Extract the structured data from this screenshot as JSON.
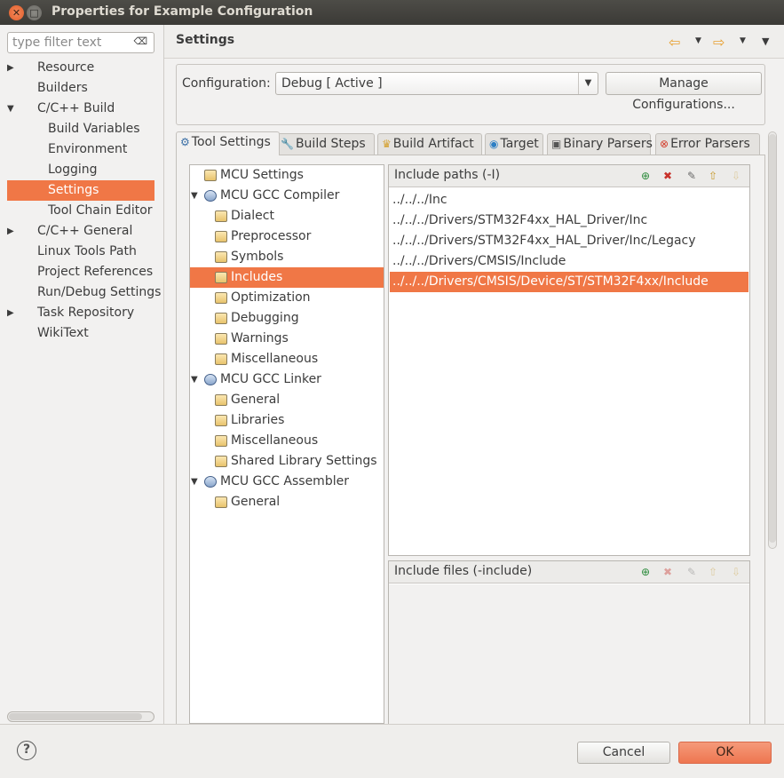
{
  "window": {
    "title": "Properties for Example Configuration"
  },
  "filter": {
    "placeholder": "type filter text"
  },
  "nav": {
    "items": [
      {
        "label": "Resource",
        "level": 0,
        "arrow": "▶"
      },
      {
        "label": "Builders",
        "level": 0
      },
      {
        "label": "C/C++ Build",
        "level": 0,
        "arrow": "▼"
      },
      {
        "label": "Build Variables",
        "level": 1
      },
      {
        "label": "Environment",
        "level": 1
      },
      {
        "label": "Logging",
        "level": 1
      },
      {
        "label": "Settings",
        "level": 1,
        "selected": true
      },
      {
        "label": "Tool Chain Editor",
        "level": 1
      },
      {
        "label": "C/C++ General",
        "level": 0,
        "arrow": "▶"
      },
      {
        "label": "Linux Tools Path",
        "level": 0
      },
      {
        "label": "Project References",
        "level": 0
      },
      {
        "label": "Run/Debug Settings",
        "level": 0
      },
      {
        "label": "Task Repository",
        "level": 0,
        "arrow": "▶"
      },
      {
        "label": "WikiText",
        "level": 0
      }
    ]
  },
  "page": {
    "title": "Settings"
  },
  "configuration": {
    "label": "Configuration:",
    "value": "Debug  [ Active ]",
    "manage_label": "Manage Configurations..."
  },
  "tabs": [
    {
      "label": "Tool Settings",
      "icon": "gear-icon",
      "active": true
    },
    {
      "label": "Build Steps",
      "icon": "wrench-icon"
    },
    {
      "label": "Build Artifact",
      "icon": "trophy-icon"
    },
    {
      "label": "Target",
      "icon": "target-icon"
    },
    {
      "label": "Binary Parsers",
      "icon": "binary-icon"
    },
    {
      "label": "Error Parsers",
      "icon": "error-icon"
    }
  ],
  "tool_tree": [
    {
      "label": "MCU Settings",
      "level": 0
    },
    {
      "label": "MCU GCC Compiler",
      "level": 0,
      "expanded": true,
      "tool": true
    },
    {
      "label": "Dialect",
      "level": 1
    },
    {
      "label": "Preprocessor",
      "level": 1
    },
    {
      "label": "Symbols",
      "level": 1
    },
    {
      "label": "Includes",
      "level": 1,
      "selected": true
    },
    {
      "label": "Optimization",
      "level": 1
    },
    {
      "label": "Debugging",
      "level": 1
    },
    {
      "label": "Warnings",
      "level": 1
    },
    {
      "label": "Miscellaneous",
      "level": 1
    },
    {
      "label": "MCU GCC Linker",
      "level": 0,
      "expanded": true,
      "tool": true
    },
    {
      "label": "General",
      "level": 1
    },
    {
      "label": "Libraries",
      "level": 1
    },
    {
      "label": "Miscellaneous",
      "level": 1
    },
    {
      "label": "Shared Library Settings",
      "level": 1
    },
    {
      "label": "MCU GCC Assembler",
      "level": 0,
      "expanded": true,
      "tool": true
    },
    {
      "label": "General",
      "level": 1
    }
  ],
  "include_paths": {
    "title": "Include paths (-I)",
    "items": [
      "../../../Inc",
      "../../../Drivers/STM32F4xx_HAL_Driver/Inc",
      "../../../Drivers/STM32F4xx_HAL_Driver/Inc/Legacy",
      "../../../Drivers/CMSIS/Include",
      "../../../Drivers/CMSIS/Device/ST/STM32F4xx/Include"
    ],
    "selected_index": 4
  },
  "include_files": {
    "title": "Include files (-include)",
    "items": []
  },
  "footer": {
    "help": "?",
    "cancel_label": "Cancel",
    "ok_label": "OK"
  }
}
